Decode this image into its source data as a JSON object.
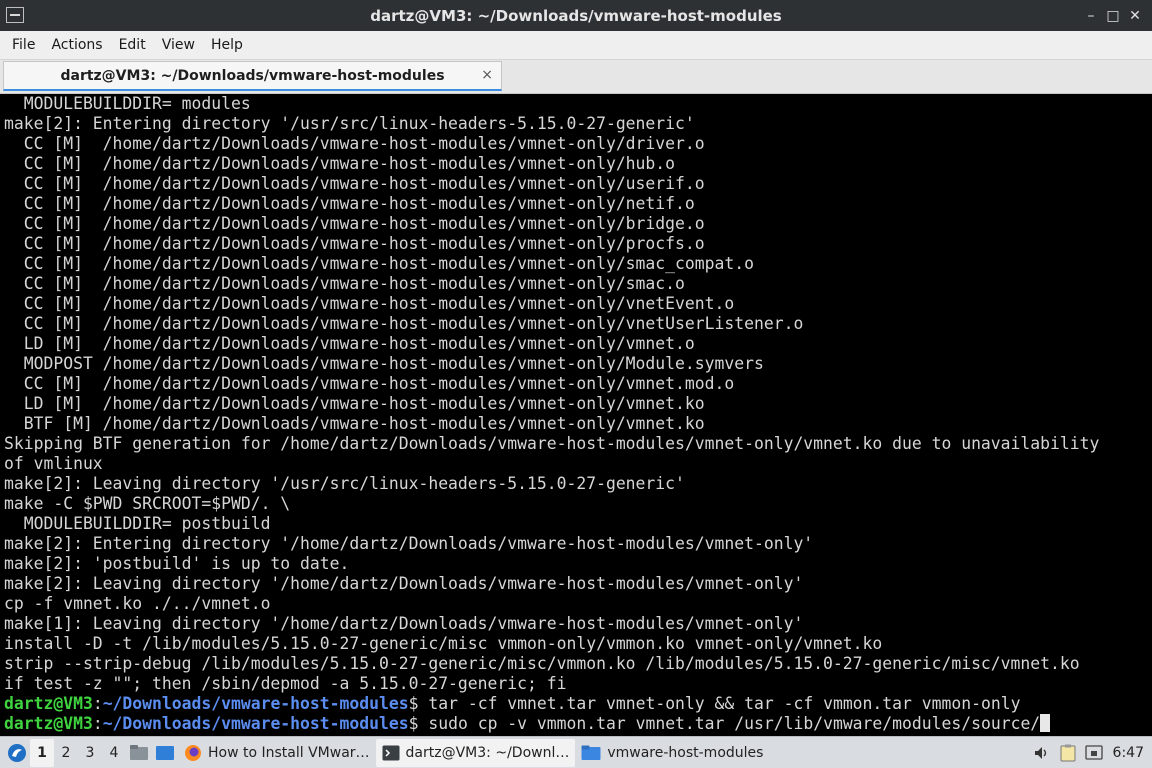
{
  "window": {
    "title": "dartz@VM3: ~/Downloads/vmware-host-modules"
  },
  "titlebar_controls": {
    "minimize": "–",
    "maximize": "□",
    "close": "✕"
  },
  "menu": [
    "File",
    "Actions",
    "Edit",
    "View",
    "Help"
  ],
  "tab": {
    "label": "dartz@VM3: ~/Downloads/vmware-host-modules",
    "close": "×"
  },
  "terminal": {
    "output": [
      "  MODULEBUILDDIR= modules",
      "make[2]: Entering directory '/usr/src/linux-headers-5.15.0-27-generic'",
      "  CC [M]  /home/dartz/Downloads/vmware-host-modules/vmnet-only/driver.o",
      "  CC [M]  /home/dartz/Downloads/vmware-host-modules/vmnet-only/hub.o",
      "  CC [M]  /home/dartz/Downloads/vmware-host-modules/vmnet-only/userif.o",
      "  CC [M]  /home/dartz/Downloads/vmware-host-modules/vmnet-only/netif.o",
      "  CC [M]  /home/dartz/Downloads/vmware-host-modules/vmnet-only/bridge.o",
      "  CC [M]  /home/dartz/Downloads/vmware-host-modules/vmnet-only/procfs.o",
      "  CC [M]  /home/dartz/Downloads/vmware-host-modules/vmnet-only/smac_compat.o",
      "  CC [M]  /home/dartz/Downloads/vmware-host-modules/vmnet-only/smac.o",
      "  CC [M]  /home/dartz/Downloads/vmware-host-modules/vmnet-only/vnetEvent.o",
      "  CC [M]  /home/dartz/Downloads/vmware-host-modules/vmnet-only/vnetUserListener.o",
      "  LD [M]  /home/dartz/Downloads/vmware-host-modules/vmnet-only/vmnet.o",
      "  MODPOST /home/dartz/Downloads/vmware-host-modules/vmnet-only/Module.symvers",
      "  CC [M]  /home/dartz/Downloads/vmware-host-modules/vmnet-only/vmnet.mod.o",
      "  LD [M]  /home/dartz/Downloads/vmware-host-modules/vmnet-only/vmnet.ko",
      "  BTF [M] /home/dartz/Downloads/vmware-host-modules/vmnet-only/vmnet.ko",
      "Skipping BTF generation for /home/dartz/Downloads/vmware-host-modules/vmnet-only/vmnet.ko due to unavailability",
      "of vmlinux",
      "make[2]: Leaving directory '/usr/src/linux-headers-5.15.0-27-generic'",
      "make -C $PWD SRCROOT=$PWD/. \\",
      "  MODULEBUILDDIR= postbuild",
      "make[2]: Entering directory '/home/dartz/Downloads/vmware-host-modules/vmnet-only'",
      "make[2]: 'postbuild' is up to date.",
      "make[2]: Leaving directory '/home/dartz/Downloads/vmware-host-modules/vmnet-only'",
      "cp -f vmnet.ko ./../vmnet.o",
      "make[1]: Leaving directory '/home/dartz/Downloads/vmware-host-modules/vmnet-only'",
      "install -D -t /lib/modules/5.15.0-27-generic/misc vmmon-only/vmmon.ko vmnet-only/vmnet.ko",
      "strip --strip-debug /lib/modules/5.15.0-27-generic/misc/vmmon.ko /lib/modules/5.15.0-27-generic/misc/vmnet.ko",
      "if test -z \"\"; then /sbin/depmod -a 5.15.0-27-generic; fi"
    ],
    "prompts": [
      {
        "user": "dartz@VM3",
        "sep": ":",
        "path": "~/Downloads/vmware-host-modules",
        "symbol": "$ ",
        "command": "tar -cf vmnet.tar vmnet-only && tar -cf vmmon.tar vmmon-only"
      },
      {
        "user": "dartz@VM3",
        "sep": ":",
        "path": "~/Downloads/vmware-host-modules",
        "symbol": "$ ",
        "command": "sudo cp -v vmmon.tar vmnet.tar /usr/lib/vmware/modules/source/"
      }
    ]
  },
  "taskbar": {
    "workspaces": [
      "1",
      "2",
      "3",
      "4"
    ],
    "active_workspace": "1",
    "tasks": [
      {
        "label": "How to Install VMwar…",
        "icon": "firefox-icon"
      },
      {
        "label": "dartz@VM3: ~/Downl…",
        "icon": "terminal-icon"
      },
      {
        "label": "vmware-host-modules",
        "icon": "folder-icon"
      }
    ],
    "clock": "6:47"
  },
  "colors": {
    "prompt_user": "#3fd43f",
    "prompt_path": "#5b8df0",
    "terminal_text": "#d6d6d6",
    "titlebar": "#2d3134",
    "tab_accent": "#3d8ee0"
  }
}
